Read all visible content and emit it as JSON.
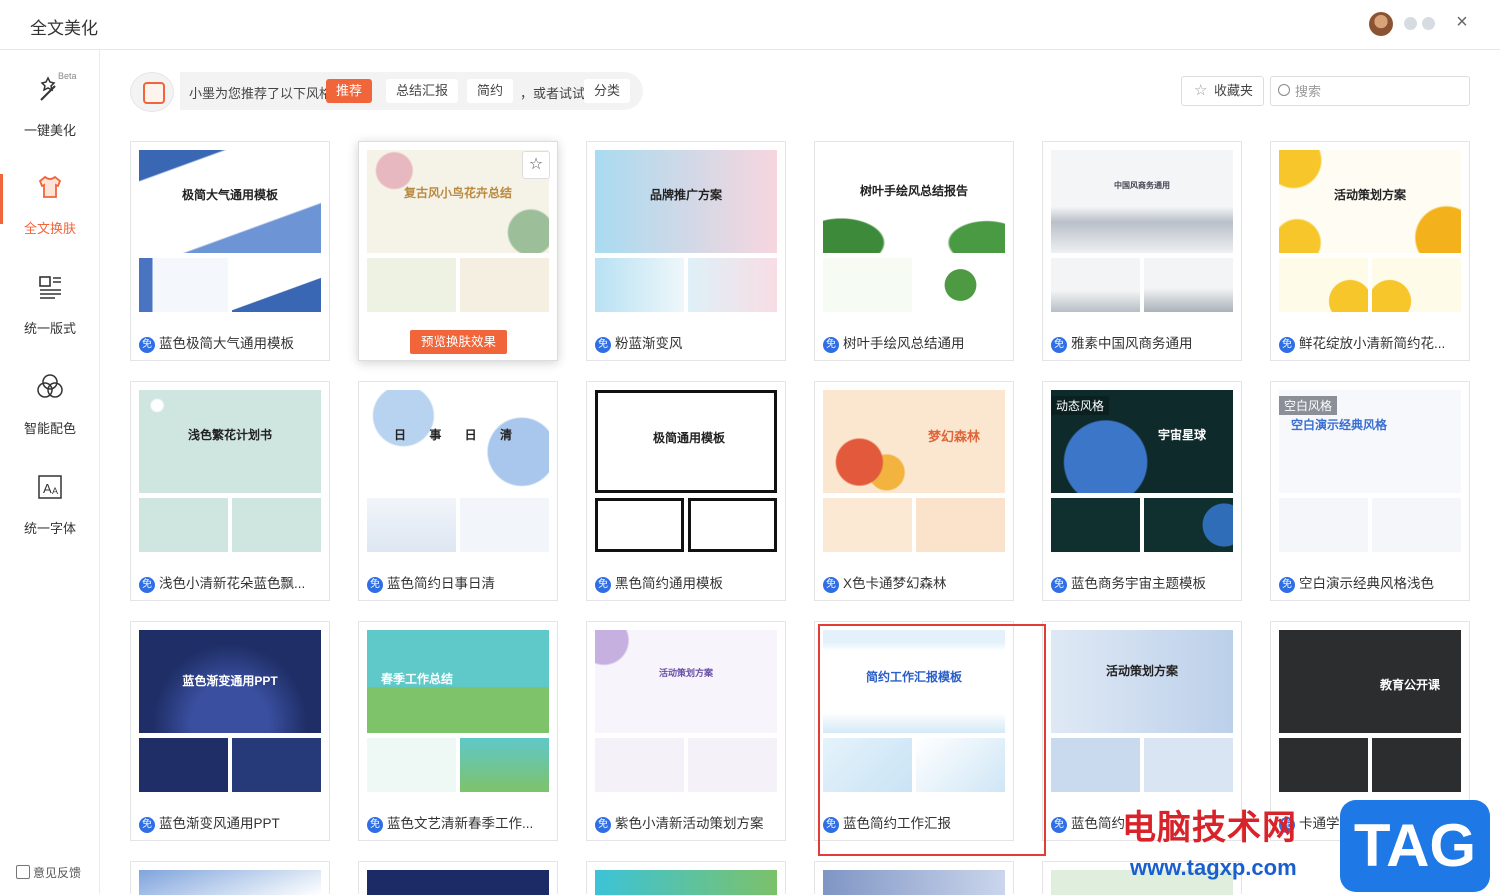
{
  "window": {
    "title": "全文美化",
    "close_label": "×"
  },
  "sidebar": {
    "items": [
      {
        "label": "一键美化",
        "badge": "Beta"
      },
      {
        "label": "全文换肤"
      },
      {
        "label": "统一版式"
      },
      {
        "label": "智能配色"
      },
      {
        "label": "统一字体"
      }
    ],
    "feedback": "意见反馈"
  },
  "topbar": {
    "suggest_text": "小墨为您推荐了以下风格",
    "chips": [
      "推荐",
      "总结汇报",
      "简约"
    ],
    "or_text": "，或者试试",
    "category": "分类",
    "favorites": "收藏夹",
    "search_placeholder": "搜索"
  },
  "colors": {
    "accent": "#f0653a",
    "free_badge": "#2f6ee5",
    "highlight": "#e33b35"
  },
  "templates": [
    {
      "name": "蓝色极简大气通用模板",
      "slide_title": "极简大气通用模板"
    },
    {
      "name": "复古风小鸟花卉总结",
      "slide_title": "复古风小鸟花卉总结",
      "hover_button": "预览换肤效果"
    },
    {
      "name": "粉蓝渐变风",
      "slide_title": "品牌推广方案"
    },
    {
      "name": "树叶手绘风总结通用",
      "slide_title": "树叶手绘风总结报告"
    },
    {
      "name": "雅素中国风商务通用",
      "slide_title": "中国风商务通用"
    },
    {
      "name": "鲜花绽放小清新简约花...",
      "slide_title": "活动策划方案"
    },
    {
      "name": "浅色小清新花朵蓝色飘...",
      "slide_title": "浅色繁花计划书"
    },
    {
      "name": "蓝色简约日事日清",
      "slide_title": "日 事 日 清"
    },
    {
      "name": "黑色简约通用模板",
      "slide_title": "极简通用模板"
    },
    {
      "name": "X色卡通梦幻森林",
      "slide_title": "梦幻森林"
    },
    {
      "name": "蓝色商务宇宙主题模板",
      "slide_title": "宇宙星球",
      "tag": "动态风格"
    },
    {
      "name": "空白演示经典风格浅色",
      "slide_title": "空白演示经典风格",
      "tag": "空白风格"
    },
    {
      "name": "蓝色渐变风通用PPT",
      "slide_title": "蓝色渐变通用PPT"
    },
    {
      "name": "蓝色文艺清新春季工作...",
      "slide_title": "春季工作总结"
    },
    {
      "name": "紫色小清新活动策划方案",
      "slide_title": "活动策划方案"
    },
    {
      "name": "蓝色简约工作汇报",
      "slide_title": "简约工作汇报模板"
    },
    {
      "name": "蓝色简约",
      "slide_title": "活动策划方案"
    },
    {
      "name": "卡通学...",
      "slide_title": "教育公开课"
    }
  ],
  "free_badge": "免",
  "watermark": {
    "text": "电脑技术网",
    "url": "www.tagxp.com",
    "logo": "TAG"
  }
}
